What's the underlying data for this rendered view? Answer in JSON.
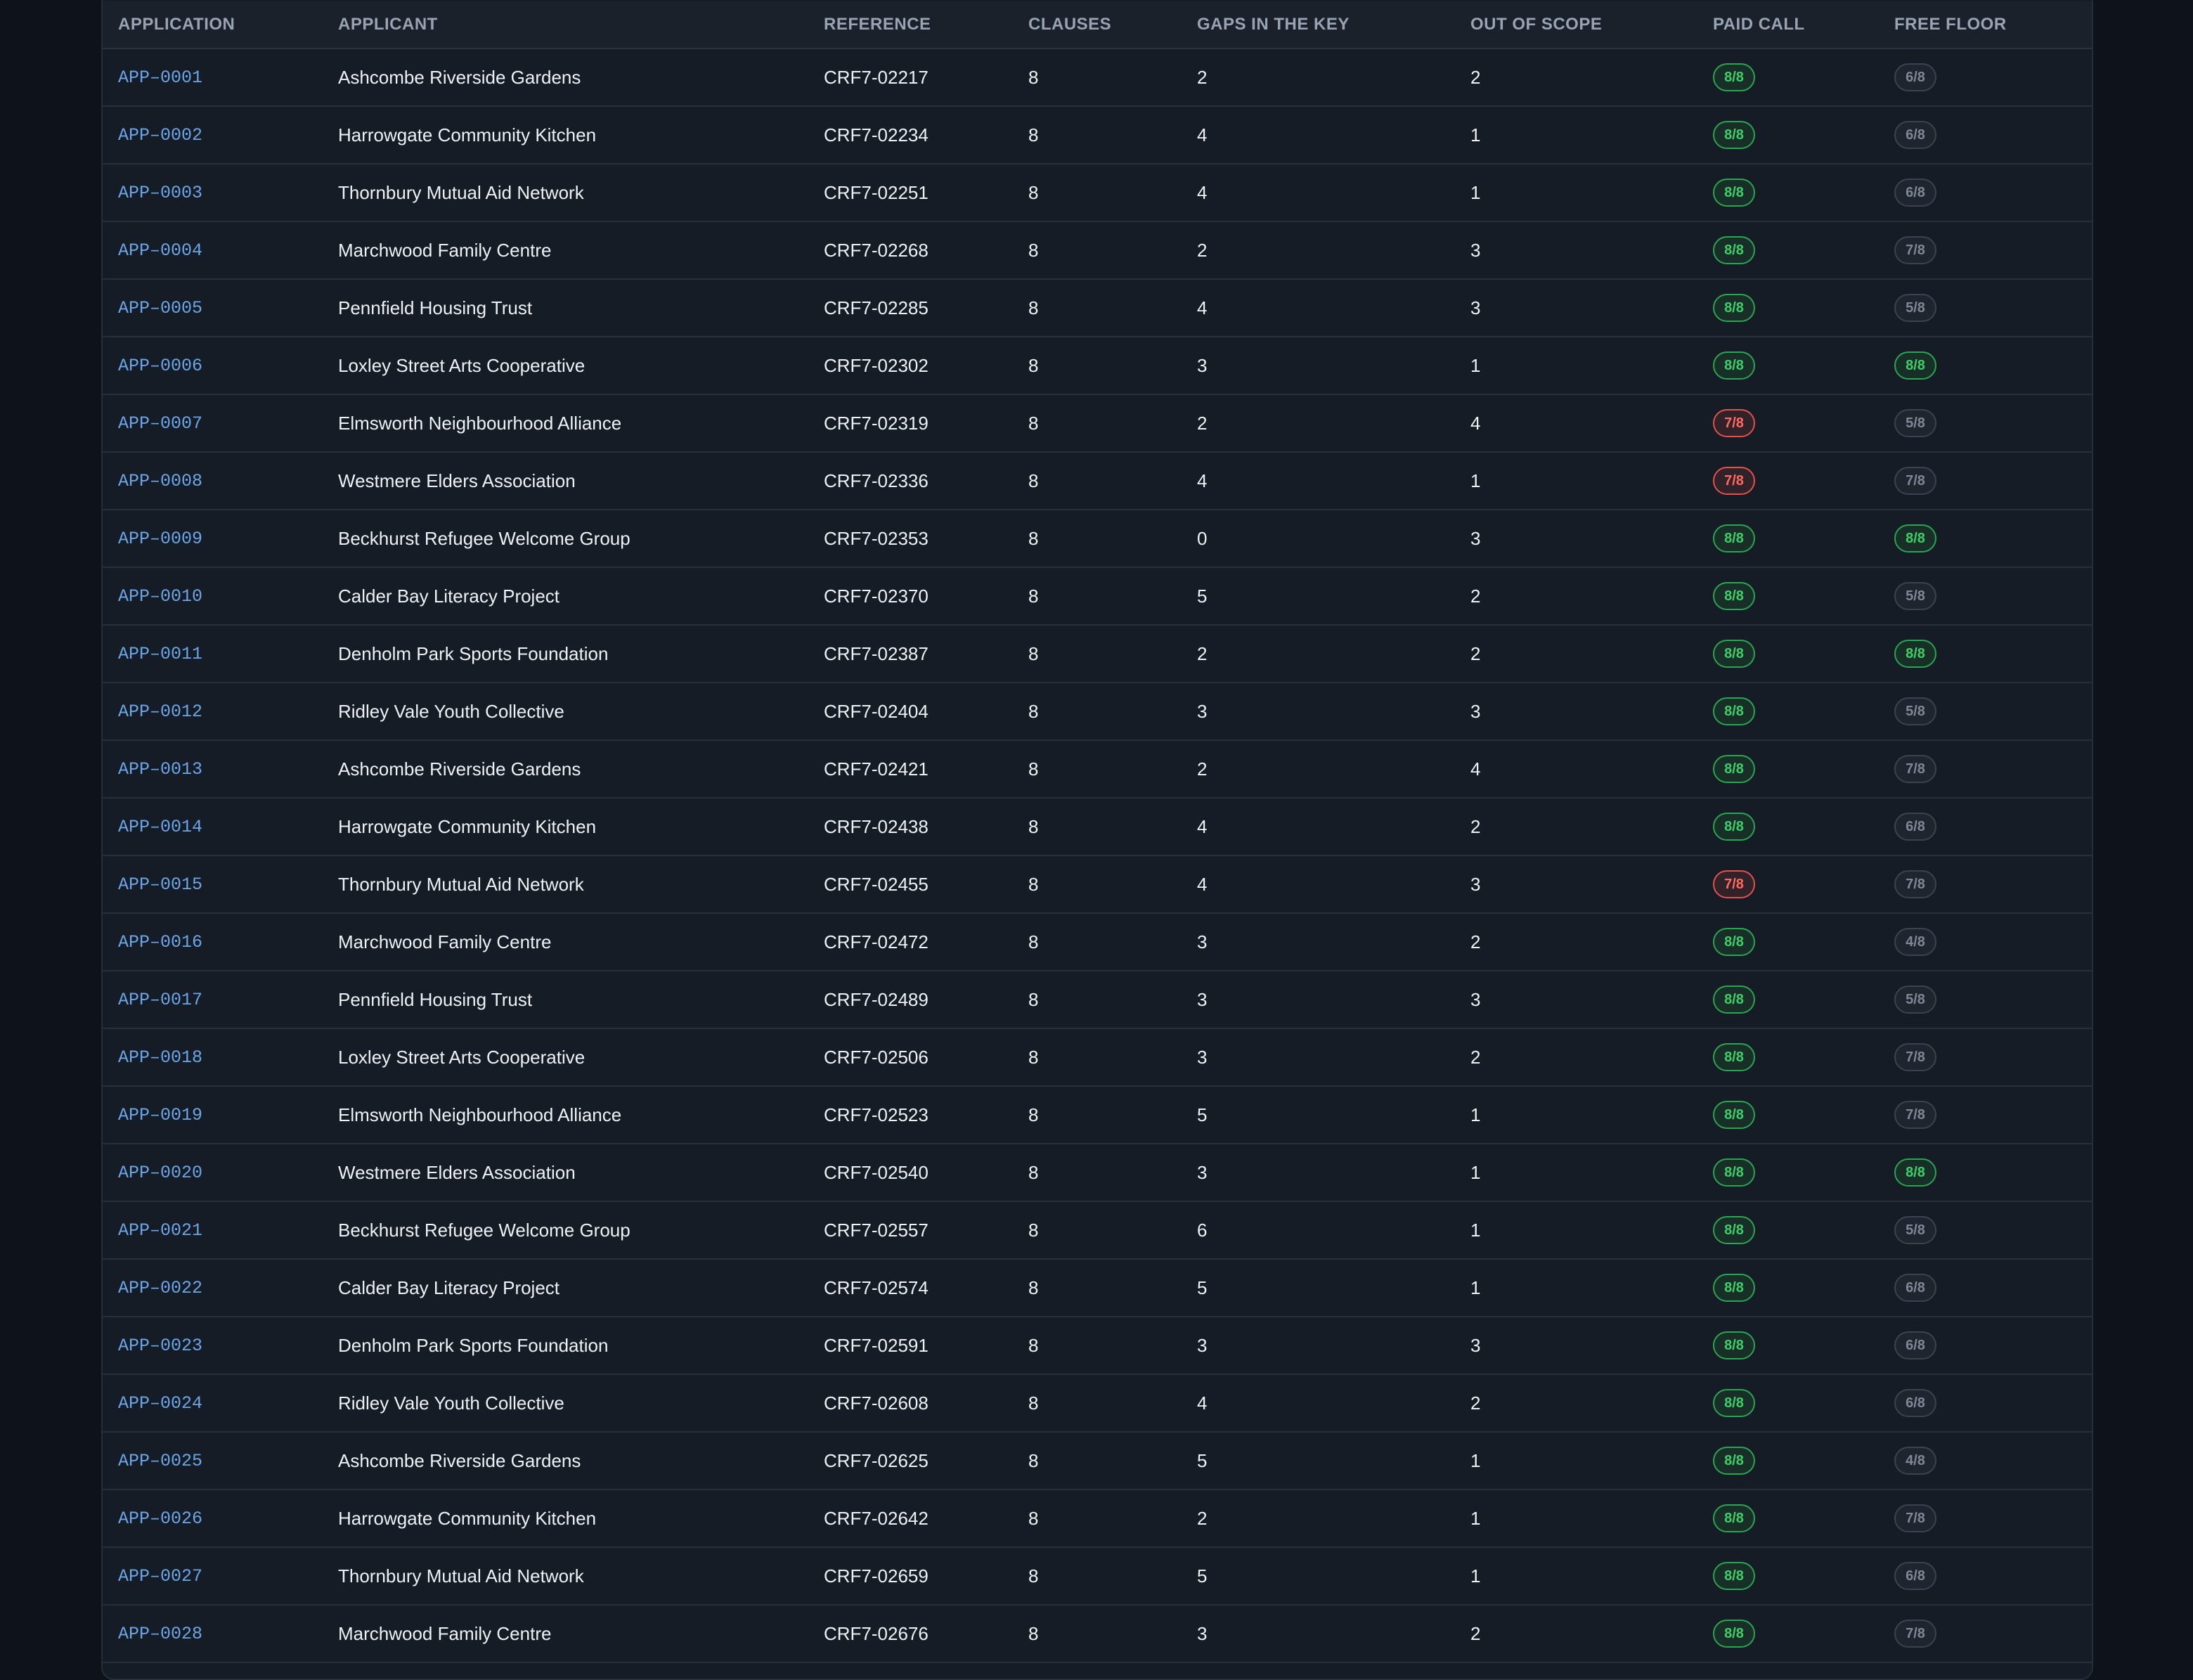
{
  "table": {
    "headers": {
      "application": "APPLICATION",
      "applicant": "APPLICANT",
      "reference": "REFERENCE",
      "clauses": "CLAUSES",
      "gaps": "GAPS IN THE KEY",
      "out_of_scope": "OUT OF SCOPE",
      "paid_call": "PAID CALL",
      "free_floor": "FREE FLOOR"
    },
    "rows": [
      {
        "application": "APP–0001",
        "applicant": "Ashcombe Riverside Gardens",
        "reference": "CRF7-02217",
        "clauses": "8",
        "gaps": "2",
        "out_of_scope": "2",
        "paid_call": "8/8",
        "paid_call_status": "pass",
        "free_floor": "6/8",
        "free_floor_status": "muted"
      },
      {
        "application": "APP–0002",
        "applicant": "Harrowgate Community Kitchen",
        "reference": "CRF7-02234",
        "clauses": "8",
        "gaps": "4",
        "out_of_scope": "1",
        "paid_call": "8/8",
        "paid_call_status": "pass",
        "free_floor": "6/8",
        "free_floor_status": "muted"
      },
      {
        "application": "APP–0003",
        "applicant": "Thornbury Mutual Aid Network",
        "reference": "CRF7-02251",
        "clauses": "8",
        "gaps": "4",
        "out_of_scope": "1",
        "paid_call": "8/8",
        "paid_call_status": "pass",
        "free_floor": "6/8",
        "free_floor_status": "muted"
      },
      {
        "application": "APP–0004",
        "applicant": "Marchwood Family Centre",
        "reference": "CRF7-02268",
        "clauses": "8",
        "gaps": "2",
        "out_of_scope": "3",
        "paid_call": "8/8",
        "paid_call_status": "pass",
        "free_floor": "7/8",
        "free_floor_status": "muted"
      },
      {
        "application": "APP–0005",
        "applicant": "Pennfield Housing Trust",
        "reference": "CRF7-02285",
        "clauses": "8",
        "gaps": "4",
        "out_of_scope": "3",
        "paid_call": "8/8",
        "paid_call_status": "pass",
        "free_floor": "5/8",
        "free_floor_status": "muted"
      },
      {
        "application": "APP–0006",
        "applicant": "Loxley Street Arts Cooperative",
        "reference": "CRF7-02302",
        "clauses": "8",
        "gaps": "3",
        "out_of_scope": "1",
        "paid_call": "8/8",
        "paid_call_status": "pass",
        "free_floor": "8/8",
        "free_floor_status": "pass"
      },
      {
        "application": "APP–0007",
        "applicant": "Elmsworth Neighbourhood Alliance",
        "reference": "CRF7-02319",
        "clauses": "8",
        "gaps": "2",
        "out_of_scope": "4",
        "paid_call": "7/8",
        "paid_call_status": "fail",
        "free_floor": "5/8",
        "free_floor_status": "muted"
      },
      {
        "application": "APP–0008",
        "applicant": "Westmere Elders Association",
        "reference": "CRF7-02336",
        "clauses": "8",
        "gaps": "4",
        "out_of_scope": "1",
        "paid_call": "7/8",
        "paid_call_status": "fail",
        "free_floor": "7/8",
        "free_floor_status": "muted"
      },
      {
        "application": "APP–0009",
        "applicant": "Beckhurst Refugee Welcome Group",
        "reference": "CRF7-02353",
        "clauses": "8",
        "gaps": "0",
        "out_of_scope": "3",
        "paid_call": "8/8",
        "paid_call_status": "pass",
        "free_floor": "8/8",
        "free_floor_status": "pass"
      },
      {
        "application": "APP–0010",
        "applicant": "Calder Bay Literacy Project",
        "reference": "CRF7-02370",
        "clauses": "8",
        "gaps": "5",
        "out_of_scope": "2",
        "paid_call": "8/8",
        "paid_call_status": "pass",
        "free_floor": "5/8",
        "free_floor_status": "muted"
      },
      {
        "application": "APP–0011",
        "applicant": "Denholm Park Sports Foundation",
        "reference": "CRF7-02387",
        "clauses": "8",
        "gaps": "2",
        "out_of_scope": "2",
        "paid_call": "8/8",
        "paid_call_status": "pass",
        "free_floor": "8/8",
        "free_floor_status": "pass"
      },
      {
        "application": "APP–0012",
        "applicant": "Ridley Vale Youth Collective",
        "reference": "CRF7-02404",
        "clauses": "8",
        "gaps": "3",
        "out_of_scope": "3",
        "paid_call": "8/8",
        "paid_call_status": "pass",
        "free_floor": "5/8",
        "free_floor_status": "muted"
      },
      {
        "application": "APP–0013",
        "applicant": "Ashcombe Riverside Gardens",
        "reference": "CRF7-02421",
        "clauses": "8",
        "gaps": "2",
        "out_of_scope": "4",
        "paid_call": "8/8",
        "paid_call_status": "pass",
        "free_floor": "7/8",
        "free_floor_status": "muted"
      },
      {
        "application": "APP–0014",
        "applicant": "Harrowgate Community Kitchen",
        "reference": "CRF7-02438",
        "clauses": "8",
        "gaps": "4",
        "out_of_scope": "2",
        "paid_call": "8/8",
        "paid_call_status": "pass",
        "free_floor": "6/8",
        "free_floor_status": "muted"
      },
      {
        "application": "APP–0015",
        "applicant": "Thornbury Mutual Aid Network",
        "reference": "CRF7-02455",
        "clauses": "8",
        "gaps": "4",
        "out_of_scope": "3",
        "paid_call": "7/8",
        "paid_call_status": "fail",
        "free_floor": "7/8",
        "free_floor_status": "muted"
      },
      {
        "application": "APP–0016",
        "applicant": "Marchwood Family Centre",
        "reference": "CRF7-02472",
        "clauses": "8",
        "gaps": "3",
        "out_of_scope": "2",
        "paid_call": "8/8",
        "paid_call_status": "pass",
        "free_floor": "4/8",
        "free_floor_status": "muted"
      },
      {
        "application": "APP–0017",
        "applicant": "Pennfield Housing Trust",
        "reference": "CRF7-02489",
        "clauses": "8",
        "gaps": "3",
        "out_of_scope": "3",
        "paid_call": "8/8",
        "paid_call_status": "pass",
        "free_floor": "5/8",
        "free_floor_status": "muted"
      },
      {
        "application": "APP–0018",
        "applicant": "Loxley Street Arts Cooperative",
        "reference": "CRF7-02506",
        "clauses": "8",
        "gaps": "3",
        "out_of_scope": "2",
        "paid_call": "8/8",
        "paid_call_status": "pass",
        "free_floor": "7/8",
        "free_floor_status": "muted"
      },
      {
        "application": "APP–0019",
        "applicant": "Elmsworth Neighbourhood Alliance",
        "reference": "CRF7-02523",
        "clauses": "8",
        "gaps": "5",
        "out_of_scope": "1",
        "paid_call": "8/8",
        "paid_call_status": "pass",
        "free_floor": "7/8",
        "free_floor_status": "muted"
      },
      {
        "application": "APP–0020",
        "applicant": "Westmere Elders Association",
        "reference": "CRF7-02540",
        "clauses": "8",
        "gaps": "3",
        "out_of_scope": "1",
        "paid_call": "8/8",
        "paid_call_status": "pass",
        "free_floor": "8/8",
        "free_floor_status": "pass"
      },
      {
        "application": "APP–0021",
        "applicant": "Beckhurst Refugee Welcome Group",
        "reference": "CRF7-02557",
        "clauses": "8",
        "gaps": "6",
        "out_of_scope": "1",
        "paid_call": "8/8",
        "paid_call_status": "pass",
        "free_floor": "5/8",
        "free_floor_status": "muted"
      },
      {
        "application": "APP–0022",
        "applicant": "Calder Bay Literacy Project",
        "reference": "CRF7-02574",
        "clauses": "8",
        "gaps": "5",
        "out_of_scope": "1",
        "paid_call": "8/8",
        "paid_call_status": "pass",
        "free_floor": "6/8",
        "free_floor_status": "muted"
      },
      {
        "application": "APP–0023",
        "applicant": "Denholm Park Sports Foundation",
        "reference": "CRF7-02591",
        "clauses": "8",
        "gaps": "3",
        "out_of_scope": "3",
        "paid_call": "8/8",
        "paid_call_status": "pass",
        "free_floor": "6/8",
        "free_floor_status": "muted"
      },
      {
        "application": "APP–0024",
        "applicant": "Ridley Vale Youth Collective",
        "reference": "CRF7-02608",
        "clauses": "8",
        "gaps": "4",
        "out_of_scope": "2",
        "paid_call": "8/8",
        "paid_call_status": "pass",
        "free_floor": "6/8",
        "free_floor_status": "muted"
      },
      {
        "application": "APP–0025",
        "applicant": "Ashcombe Riverside Gardens",
        "reference": "CRF7-02625",
        "clauses": "8",
        "gaps": "5",
        "out_of_scope": "1",
        "paid_call": "8/8",
        "paid_call_status": "pass",
        "free_floor": "4/8",
        "free_floor_status": "muted"
      },
      {
        "application": "APP–0026",
        "applicant": "Harrowgate Community Kitchen",
        "reference": "CRF7-02642",
        "clauses": "8",
        "gaps": "2",
        "out_of_scope": "1",
        "paid_call": "8/8",
        "paid_call_status": "pass",
        "free_floor": "7/8",
        "free_floor_status": "muted"
      },
      {
        "application": "APP–0027",
        "applicant": "Thornbury Mutual Aid Network",
        "reference": "CRF7-02659",
        "clauses": "8",
        "gaps": "5",
        "out_of_scope": "1",
        "paid_call": "8/8",
        "paid_call_status": "pass",
        "free_floor": "6/8",
        "free_floor_status": "muted"
      },
      {
        "application": "APP–0028",
        "applicant": "Marchwood Family Centre",
        "reference": "CRF7-02676",
        "clauses": "8",
        "gaps": "3",
        "out_of_scope": "2",
        "paid_call": "8/8",
        "paid_call_status": "pass",
        "free_floor": "7/8",
        "free_floor_status": "muted"
      }
    ]
  },
  "colors": {
    "background": "#0e131b",
    "panel": "#161c25",
    "link": "#6aa6e8",
    "pass": "#3fcf6a",
    "fail": "#ff6b60",
    "muted": "#7f8896"
  }
}
